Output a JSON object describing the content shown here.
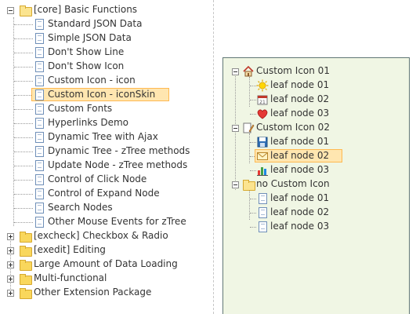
{
  "demo_menu": {
    "root": {
      "label": "[core] Basic Functions",
      "icon": "open-folder-icon"
    },
    "items": [
      {
        "label": "Standard JSON Data",
        "icon": "page-icon"
      },
      {
        "label": "Simple JSON Data",
        "icon": "page-icon"
      },
      {
        "label": "Don't Show Line",
        "icon": "page-icon"
      },
      {
        "label": "Don't Show Icon",
        "icon": "page-icon"
      },
      {
        "label": "Custom Icon - icon",
        "icon": "page-icon"
      },
      {
        "label": "Custom Icon - iconSkin",
        "icon": "page-icon",
        "selected": true
      },
      {
        "label": "Custom Fonts",
        "icon": "page-icon"
      },
      {
        "label": "Hyperlinks Demo",
        "icon": "page-icon"
      },
      {
        "label": "Dynamic Tree with Ajax",
        "icon": "page-icon"
      },
      {
        "label": "Dynamic Tree - zTree methods",
        "icon": "page-icon"
      },
      {
        "label": "Update Node - zTree methods",
        "icon": "page-icon"
      },
      {
        "label": "Control of Click Node",
        "icon": "page-icon"
      },
      {
        "label": "Control of Expand Node",
        "icon": "page-icon"
      },
      {
        "label": "Search Nodes",
        "icon": "page-icon"
      },
      {
        "label": "Other Mouse Events for zTree",
        "icon": "page-icon"
      }
    ],
    "closed_folders": [
      {
        "label": "[excheck] Checkbox & Radio",
        "icon": "folder-icon"
      },
      {
        "label": "[exedit] Editing",
        "icon": "folder-icon"
      },
      {
        "label": "Large Amount of Data Loading",
        "icon": "folder-icon"
      },
      {
        "label": "Multi-functional",
        "icon": "folder-icon"
      },
      {
        "label": "Other Extension Package",
        "icon": "folder-icon"
      }
    ]
  },
  "demo_tree": {
    "background": "#f0f6e4",
    "groups": [
      {
        "label": "Custom Icon 01",
        "icon": "house-icon",
        "children": [
          {
            "label": "leaf node 01",
            "icon": "sun-icon"
          },
          {
            "label": "leaf node 02",
            "icon": "calendar-icon"
          },
          {
            "label": "leaf node 03",
            "icon": "heart-icon"
          }
        ]
      },
      {
        "label": "Custom Icon 02",
        "icon": "edit-page-icon",
        "children": [
          {
            "label": "leaf node 01",
            "icon": "save-icon"
          },
          {
            "label": "leaf node 02",
            "icon": "mail-icon",
            "selected": true
          },
          {
            "label": "leaf node 03",
            "icon": "bar-chart-icon"
          }
        ]
      },
      {
        "label": "no Custom Icon",
        "icon": "open-folder-icon",
        "children": [
          {
            "label": "leaf node 01",
            "icon": "page-icon"
          },
          {
            "label": "leaf node 02",
            "icon": "page-icon"
          },
          {
            "label": "leaf node 03",
            "icon": "page-icon"
          }
        ]
      }
    ]
  },
  "colors": {
    "selected_bg": "#ffe6b0",
    "selected_border": "#ffb951",
    "tree_border": "#617775"
  }
}
